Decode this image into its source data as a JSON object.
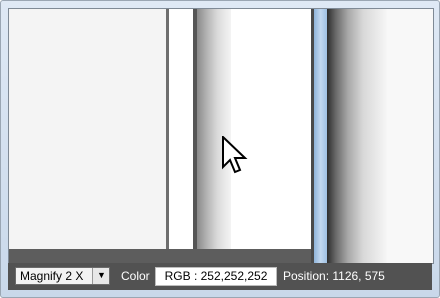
{
  "statusbar": {
    "zoom_value": "Magnify 2 X",
    "color_label": "Color",
    "rgb_value": "RGB : 252,252,252",
    "position_value": "Position: 1126, 575"
  },
  "icons": {
    "cursor": "arrow-cursor-icon",
    "dropdown": "chevron-down-icon"
  },
  "colors": {
    "statusbar_bg": "#525252",
    "window_frame": "#c9d8ea"
  }
}
